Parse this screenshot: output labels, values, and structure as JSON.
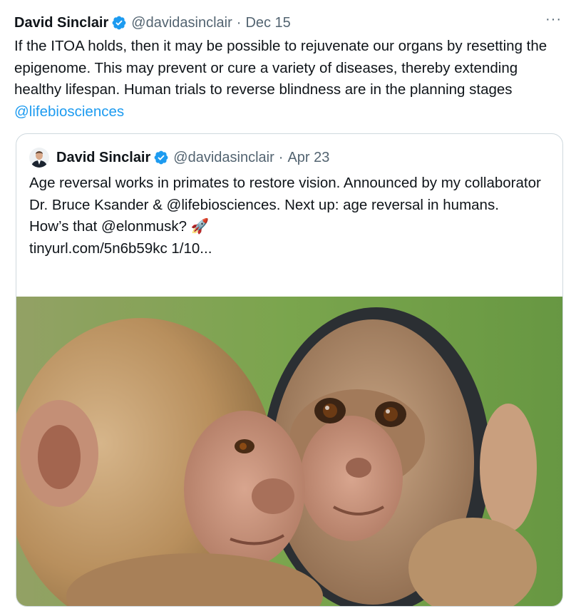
{
  "tweet": {
    "author_name": "David Sinclair",
    "handle": "@davidasinclair",
    "separator": "·",
    "date": "Dec 15",
    "more_label": "···",
    "text": "If the ITOA holds, then it may be possible to rejuvenate our organs by resetting the epigenome. This may prevent or cure a variety of diseases, thereby extending healthy lifespan. Human trials to reverse blindness are in the planning stages ",
    "mention": "@lifebiosciences"
  },
  "quoted_tweet": {
    "author_name": "David Sinclair",
    "handle": "@davidasinclair",
    "separator": "·",
    "date": "Apr 23",
    "lines": [
      "Age reversal works in primates to restore vision. Announced by my collaborator Dr. Bruce Ksander & @lifebiosciences. Next up: age reversal in humans.",
      "How’s that @elonmusk? 🚀",
      "tinyurl.com/5n6b59kc 1/10..."
    ]
  },
  "media": {
    "icon": "monkey-mirror-photo"
  },
  "colors": {
    "text": "#0f1419",
    "muted": "#536471",
    "link": "#1d9bf0",
    "verified": "#1d9bf0",
    "border": "#cfd9de"
  }
}
